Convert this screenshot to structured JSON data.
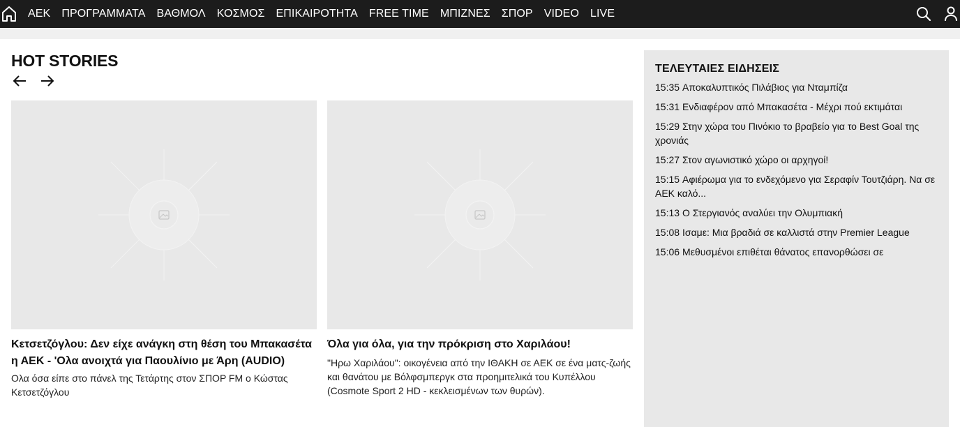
{
  "nav": {
    "home_icon": "home-icon",
    "items": [
      {
        "label": "ΑΕΚ"
      },
      {
        "label": "ΠΡΟΓΡΑΜΜΑΤΑ"
      },
      {
        "label": "ΒΑΘΜΟΛ"
      },
      {
        "label": "ΚΟΣΜΟΣ"
      },
      {
        "label": "ΕΠΙΚΑΙΡΟΤΗΤΑ"
      },
      {
        "label": "FREE TIME"
      },
      {
        "label": "ΜΠΙΖΝΕΣ"
      },
      {
        "label": "ΣΠΟΡ"
      },
      {
        "label": "VIDEO"
      },
      {
        "label": "LIVE"
      }
    ],
    "search_icon": "search-icon",
    "user_icon": "user-icon"
  },
  "hot_stories": {
    "title": "HOT STORIES",
    "prev_icon": "arrow-left-icon",
    "next_icon": "arrow-right-icon",
    "cards": [
      {
        "title": "Κετσετζόγλου: Δεν είχε ανάγκη στη θέση του Μπακασέτα η ΑΕΚ - 'Ολα ανοιχτά για Παουλίνιο με Άρη (AUDIO)",
        "description": "Ολα όσα είπε στο πάνελ της Τετάρτης στον ΣΠΟΡ FM ο Κώστας Κετσετζόγλου"
      },
      {
        "title": "Όλα για όλα, για την πρόκριση στο Χαριλάου!",
        "description": "\"Ηρω Χαριλάου\": οικογένεια από την ΙΘΑΚΗ σε ΑΕΚ σε ένα ματς-ζωής και θανάτου με Βόλφσμπεργκ στα προημιτελικά του Κυπέλλου (Cosmote Sport 2 HD - κεκλεισμένων των θυρών)."
      }
    ]
  },
  "latest_news": {
    "title": "ΤΕΛΕΥΤΑΙΕΣ ΕΙΔΗΣΕΙΣ",
    "items": [
      {
        "time": "15:35",
        "text": "Αποκαλυπτικός Πιλάβιος για Νταμπίζα"
      },
      {
        "time": "15:31",
        "text": "Ενδιαφέρον από Μπακασέτα - Μέχρι πού εκτιμάται"
      },
      {
        "time": "15:29",
        "text": "Στην χώρα του Πινόκιο το βραβείο για το Best Goal της χρονιάς"
      },
      {
        "time": "15:27",
        "text": "Στον αγωνιστικό χώρο οι αρχηγοί!"
      },
      {
        "time": "15:15",
        "text": "Αφιέρωμα για το ενδεχόμενο για Σεραφίν Τουτζιάρη. Να σε ΑΕΚ καλό..."
      },
      {
        "time": "15:13",
        "text": "Ο Στεργιανός αναλύει την Ολυμπιακή"
      },
      {
        "time": "15:08",
        "text": "Ισαμε: Μια βραδιά σε καλλιστά στην Premier League"
      },
      {
        "time": "15:06",
        "text": "Μεθυσμένοι επιθέται θάνατος επανορθώσει σε"
      }
    ]
  },
  "colors": {
    "topbar": "#1c1c1c",
    "placeholder": "#e8e8e8",
    "sidebar": "#e8e8e8"
  }
}
